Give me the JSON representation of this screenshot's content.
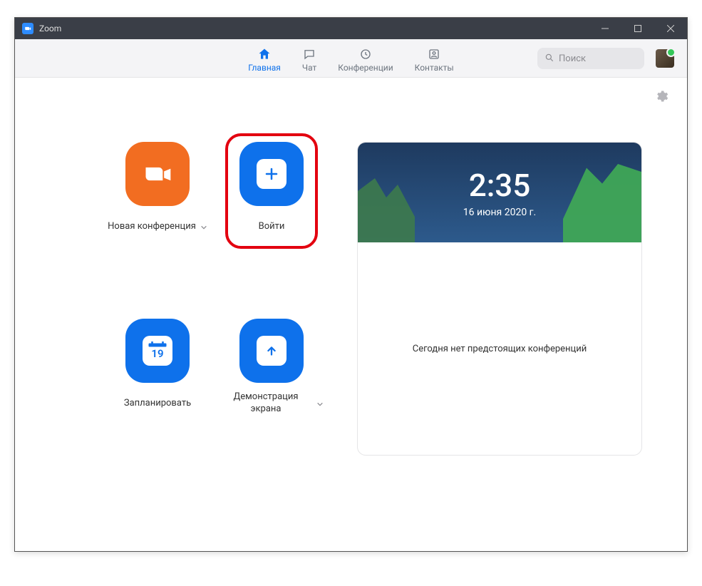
{
  "window": {
    "title": "Zoom"
  },
  "nav": {
    "home": "Главная",
    "chat": "Чат",
    "meetings": "Конференции",
    "contacts": "Контакты"
  },
  "search": {
    "placeholder": "Поиск"
  },
  "actions": {
    "new_meeting": "Новая конференция",
    "join": "Войти",
    "schedule": "Запланировать",
    "share_screen": "Демонстрация экрана",
    "calendar_day": "19"
  },
  "panel": {
    "time": "2:35",
    "date": "16 июня 2020 г.",
    "no_meetings": "Сегодня нет предстоящих конференций"
  }
}
